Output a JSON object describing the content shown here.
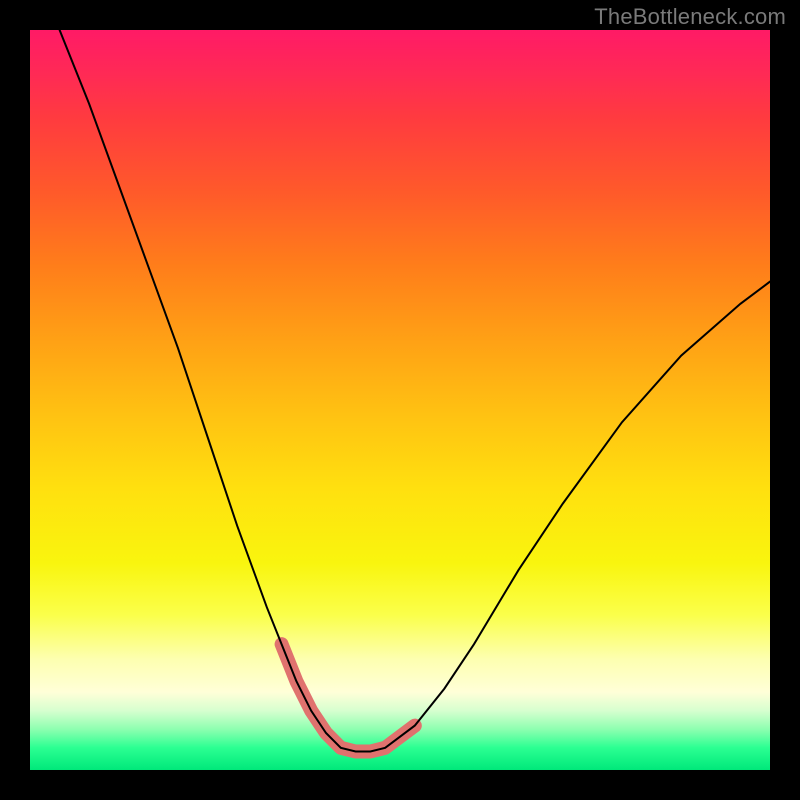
{
  "watermark": {
    "text": "TheBottleneck.com"
  },
  "chart_data": {
    "type": "line",
    "title": "",
    "xlabel": "",
    "ylabel": "",
    "xlim": [
      0,
      100
    ],
    "ylim": [
      0,
      100
    ],
    "grid": false,
    "legend": false,
    "series": [
      {
        "name": "bottleneck-curve",
        "x": [
          4,
          8,
          12,
          16,
          20,
          24,
          28,
          32,
          34,
          36,
          38,
          40,
          42,
          44,
          46,
          48,
          52,
          56,
          60,
          66,
          72,
          80,
          88,
          96,
          100
        ],
        "y": [
          100,
          90,
          79,
          68,
          57,
          45,
          33,
          22,
          17,
          12,
          8,
          5,
          3,
          2.5,
          2.5,
          3,
          6,
          11,
          17,
          27,
          36,
          47,
          56,
          63,
          66
        ]
      }
    ],
    "annotations": [
      {
        "name": "optimal-range-highlight",
        "color": "#e0726e",
        "x": [
          34,
          36,
          38,
          40,
          42,
          44,
          46,
          48,
          50,
          52
        ],
        "y": [
          17,
          12,
          8,
          5,
          3,
          2.5,
          2.5,
          3,
          4.5,
          6
        ]
      }
    ]
  }
}
